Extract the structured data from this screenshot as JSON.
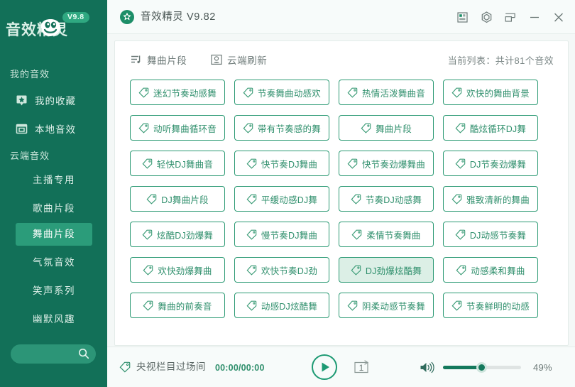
{
  "colors": {
    "sidebar_bg": "#127058",
    "accent_green": "#2c9a74",
    "active_nav": "#2b9c7a",
    "selected_btn_bg": "#dcefe6",
    "panel_bg": "#ffffff",
    "page_bg": "#f4f8f7"
  },
  "sidebar": {
    "logo_text": "音效精灵",
    "logo_badge": "V9.8",
    "groups": [
      {
        "title": "我的音效",
        "items": [
          {
            "label": "我的收藏",
            "icon": "star-badge-icon"
          },
          {
            "label": "本地音效",
            "icon": "window-folder-icon"
          }
        ]
      },
      {
        "title": "云端音效",
        "items": [
          {
            "label": "主播专用",
            "active": false
          },
          {
            "label": "歌曲片段",
            "active": false
          },
          {
            "label": "舞曲片段",
            "active": true
          },
          {
            "label": "气氛音效",
            "active": false
          },
          {
            "label": "笑声系列",
            "active": false
          },
          {
            "label": "幽默风趣",
            "active": false
          }
        ]
      }
    ],
    "search": {
      "value": "",
      "placeholder": "",
      "icon": "search-icon"
    }
  },
  "titlebar": {
    "app_icon": "app-logo-icon",
    "title": "音效精灵 V9.82",
    "buttons": [
      {
        "name": "layout-grid-icon"
      },
      {
        "name": "hexagon-settings-icon"
      },
      {
        "name": "restore-window-icon"
      },
      {
        "name": "minimize-icon"
      },
      {
        "name": "close-icon"
      }
    ]
  },
  "toolbar": {
    "playlist_label": "舞曲片段",
    "playlist_icon": "playlist-music-icon",
    "refresh_label": "云端刷新",
    "refresh_icon": "cloud-refresh-icon",
    "count_text": "当前列表：共计81个音效"
  },
  "grid": {
    "items": [
      {
        "label": "迷幻节奏动感舞",
        "selected": false
      },
      {
        "label": "节奏舞曲动感欢",
        "selected": false
      },
      {
        "label": "热情活泼舞曲音",
        "selected": false
      },
      {
        "label": "欢快的舞曲背景",
        "selected": false
      },
      {
        "label": "动听舞曲循环音",
        "selected": false
      },
      {
        "label": "带有节奏感的舞",
        "selected": false
      },
      {
        "label": "舞曲片段",
        "selected": false
      },
      {
        "label": "酷炫循环DJ舞",
        "selected": false
      },
      {
        "label": "轻快DJ舞曲音",
        "selected": false
      },
      {
        "label": "快节奏DJ舞曲",
        "selected": false
      },
      {
        "label": "快节奏劲爆舞曲",
        "selected": false
      },
      {
        "label": "DJ节奏劲爆舞",
        "selected": false
      },
      {
        "label": "DJ舞曲片段",
        "selected": false
      },
      {
        "label": "平缓动感DJ舞",
        "selected": false
      },
      {
        "label": "节奏DJ动感舞",
        "selected": false
      },
      {
        "label": "雅致清新的舞曲",
        "selected": false
      },
      {
        "label": "炫酷DJ劲爆舞",
        "selected": false
      },
      {
        "label": "慢节奏DJ舞曲",
        "selected": false
      },
      {
        "label": "柔情节奏舞曲",
        "selected": false
      },
      {
        "label": "DJ动感节奏舞",
        "selected": false
      },
      {
        "label": "欢快劲爆舞曲",
        "selected": false
      },
      {
        "label": "欢快节奏DJ劲",
        "selected": false
      },
      {
        "label": "DJ劲爆炫酷舞",
        "selected": true
      },
      {
        "label": "动感柔和舞曲",
        "selected": false
      },
      {
        "label": "舞曲的前奏音",
        "selected": false
      },
      {
        "label": "动感DJ炫酷舞",
        "selected": false
      },
      {
        "label": "阴柔动感节奏舞",
        "selected": false
      },
      {
        "label": "节奏鲜明的动感",
        "selected": false
      }
    ]
  },
  "player": {
    "track_icon": "tag-music-icon",
    "track_name": "央视栏目过场间",
    "time": "00:00/00:00",
    "play_icon": "play-icon",
    "repeat_icon": "repeat-one-icon",
    "volume_icon": "volume-icon",
    "volume_percent": "49%",
    "volume_value": 49
  }
}
